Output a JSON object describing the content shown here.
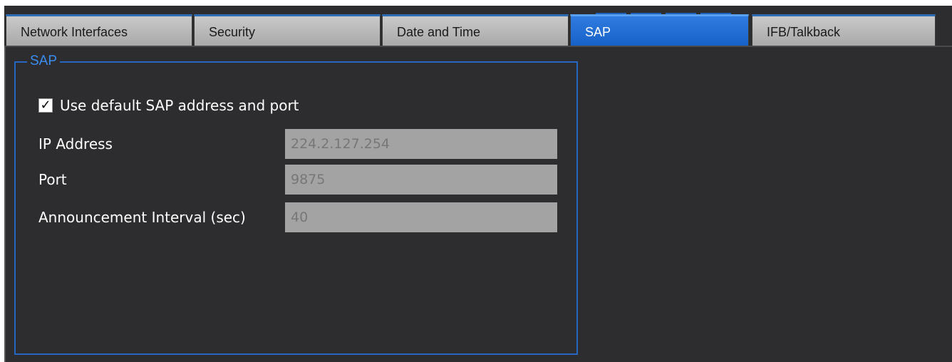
{
  "tabs": [
    {
      "label": "Network Interfaces",
      "active": false
    },
    {
      "label": "Security",
      "active": false
    },
    {
      "label": "Date and Time",
      "active": false
    },
    {
      "label": "SAP",
      "active": true
    },
    {
      "label": "IFB/Talkback",
      "active": false
    }
  ],
  "sap_group": {
    "title": "SAP",
    "use_default": {
      "label": "Use default SAP address and port",
      "checked": true
    },
    "fields": [
      {
        "label": "IP Address",
        "value": "224.2.127.254"
      },
      {
        "label": "Port",
        "value": "9875"
      },
      {
        "label": "Announcement Interval (sec)",
        "value": "40"
      }
    ]
  },
  "colors": {
    "background": "#2d2d2f",
    "accent": "#2767c2",
    "active_tab": "#1f6fd6",
    "input_bg": "#a3a3a3",
    "input_text": "#777777"
  }
}
